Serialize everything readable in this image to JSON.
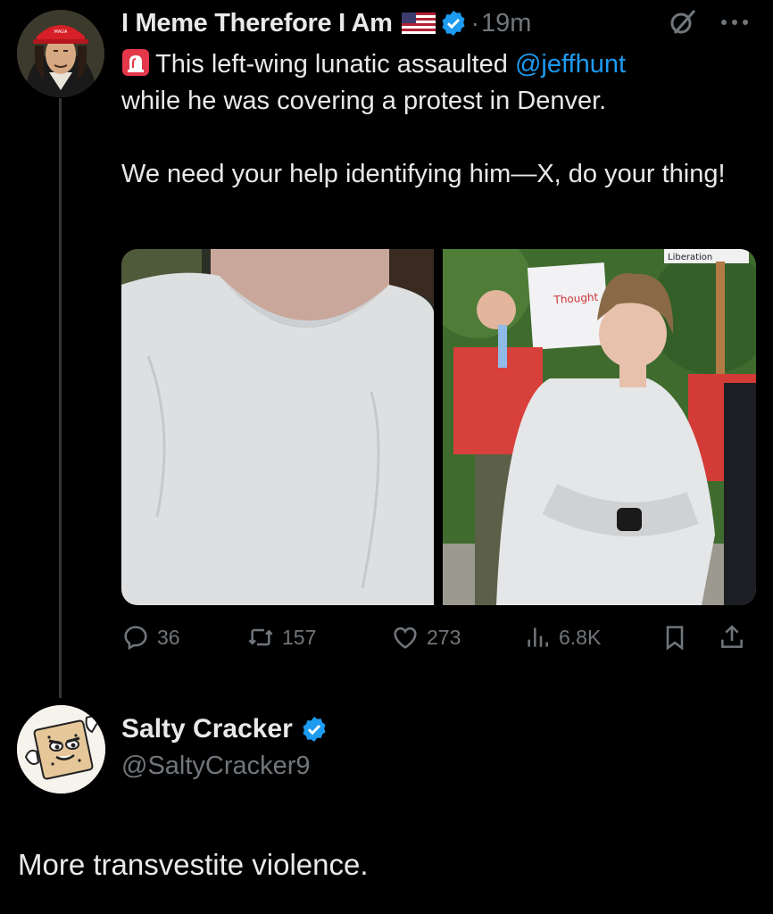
{
  "post": {
    "author_name": "I Meme Therefore I Am",
    "time_sep": "·",
    "time": "19m",
    "text_line1": "This left-wing lunatic assaulted ",
    "mention": "@jeffhunt",
    "text_line2": "while he was covering a protest in Denver.",
    "text_para2": "We need your help identifying him—X, do your thing!",
    "media_sign_text": "Liberation",
    "actions": {
      "replies": "36",
      "reposts": "157",
      "likes": "273",
      "views": "6.8K"
    }
  },
  "reply": {
    "author_name": "Salty Cracker",
    "handle": "@SaltyCracker9",
    "text": "More transvestite violence."
  },
  "icons": [
    "flag-usa-icon",
    "verified-badge-icon",
    "grok-icon",
    "more-icon",
    "siren-icon",
    "reply-icon",
    "repost-icon",
    "like-icon",
    "views-icon",
    "bookmark-icon",
    "share-icon"
  ],
  "colors": {
    "background": "#000000",
    "text": "#e7e9ea",
    "muted": "#71767b",
    "link": "#1d9bf0",
    "verified": "#1d9bf0",
    "thread_line": "#333639"
  }
}
